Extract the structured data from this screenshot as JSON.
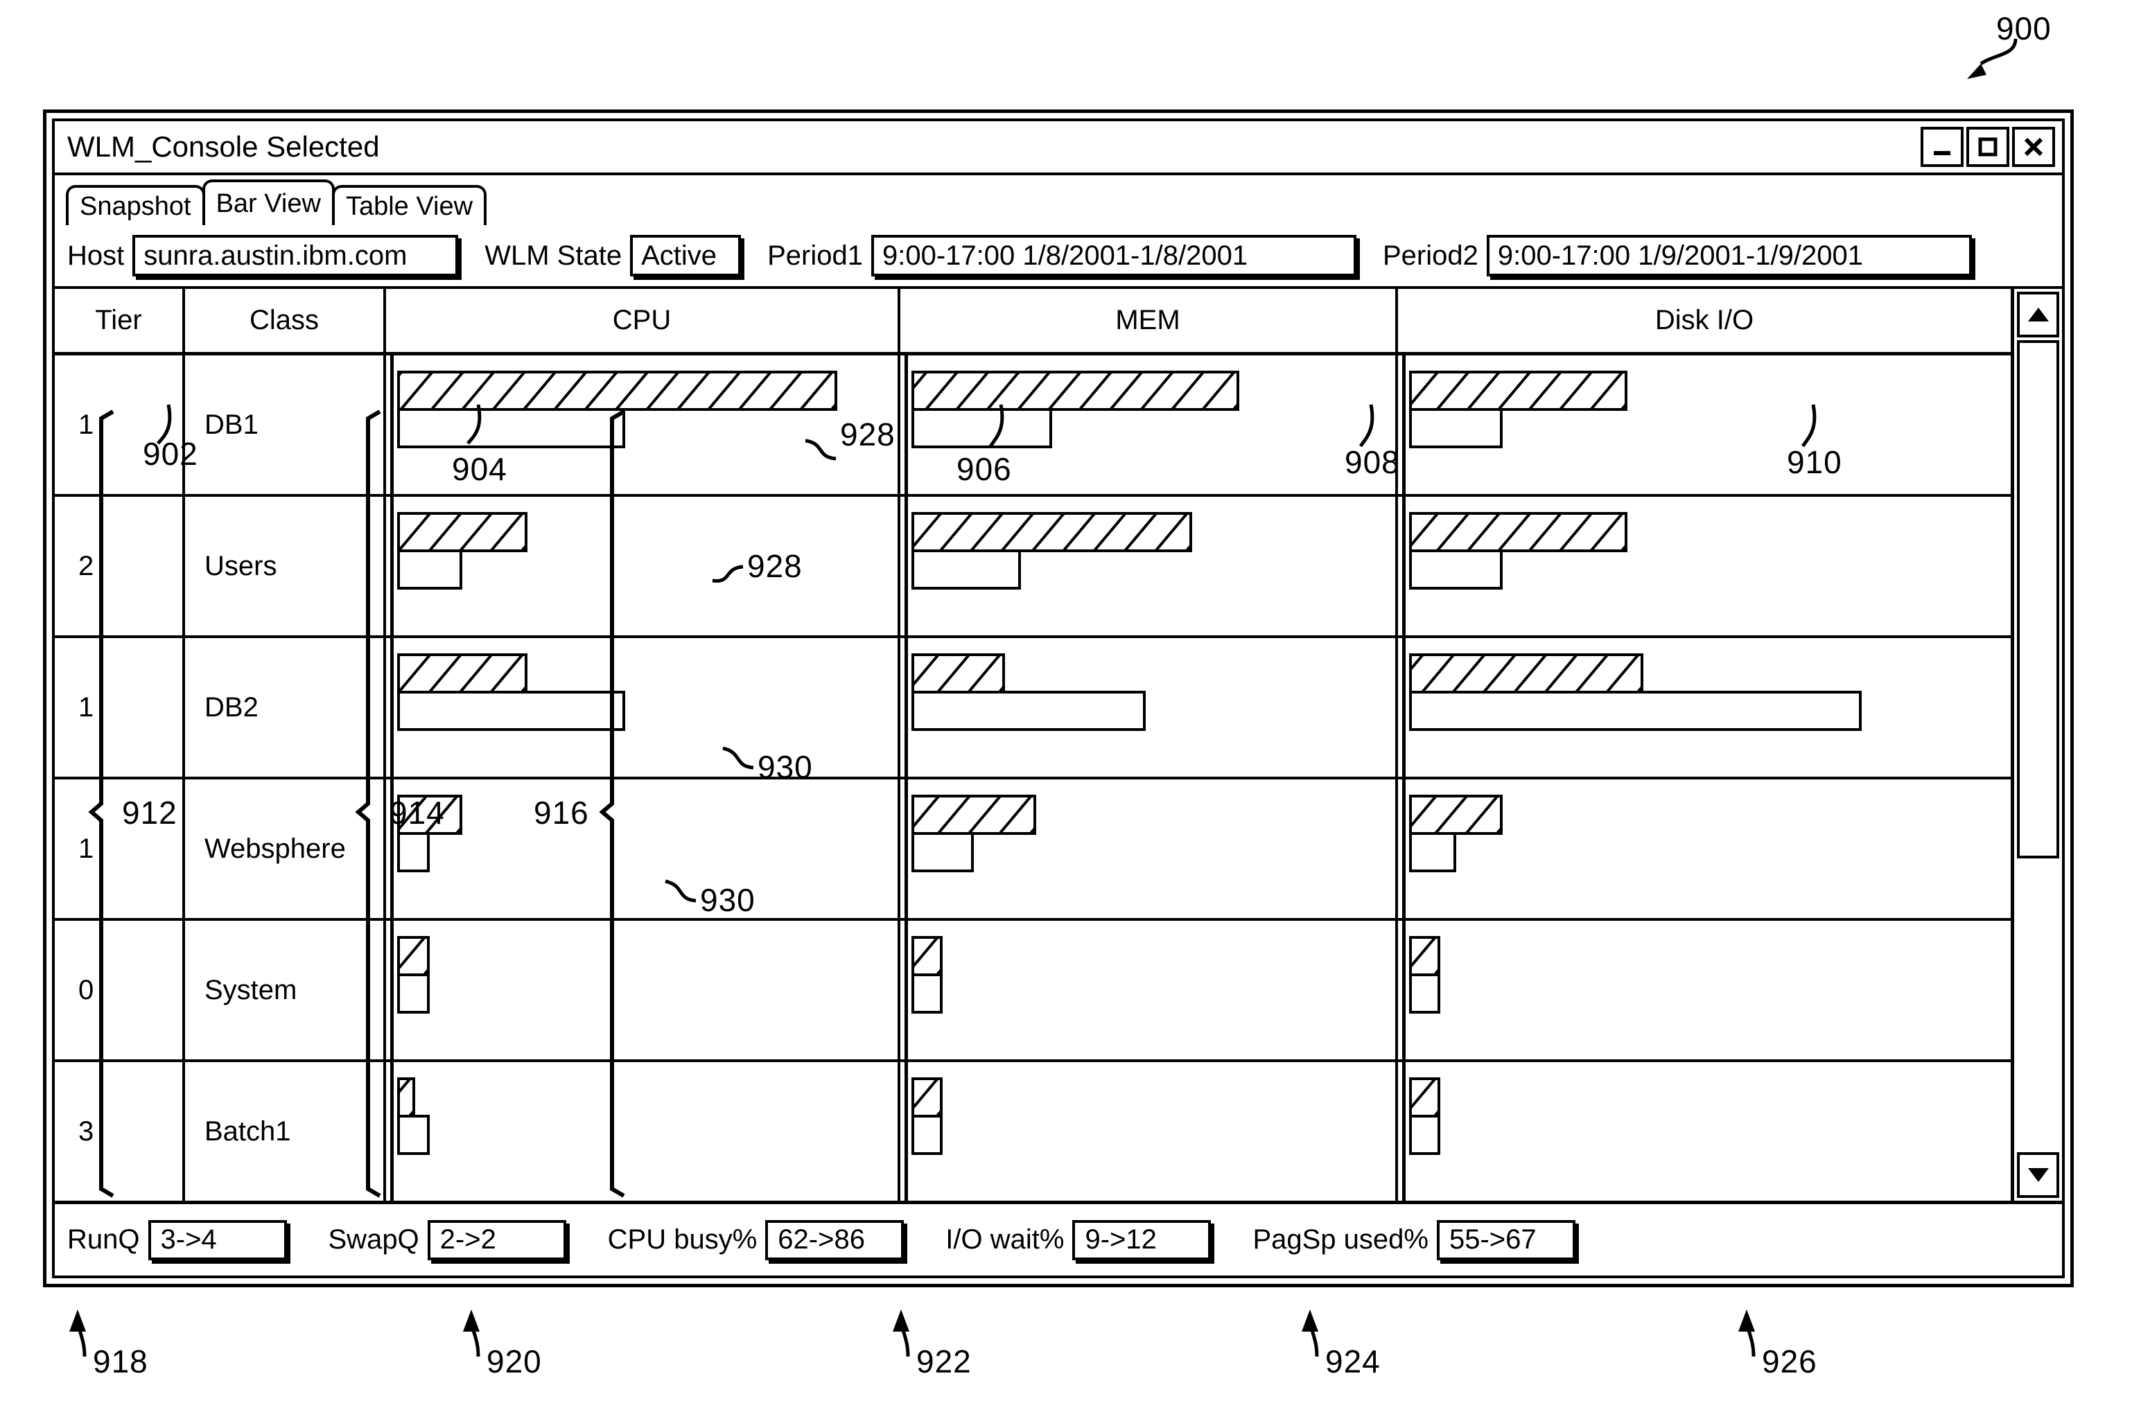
{
  "figure": {
    "reference": "900",
    "callouts": [
      {
        "id": "902",
        "target": "tier-column-annotation"
      },
      {
        "id": "904",
        "target": "class-column-annotation"
      },
      {
        "id": "906",
        "target": "cpu-column-annotation"
      },
      {
        "id": "908",
        "target": "mem-column-annotation"
      },
      {
        "id": "910",
        "target": "disk-column-annotation"
      },
      {
        "id": "912",
        "target": "tier-values-brace"
      },
      {
        "id": "914",
        "target": "class-values-brace"
      },
      {
        "id": "916",
        "target": "bar-axis-brace"
      },
      {
        "id": "928",
        "target": "period1-bar"
      },
      {
        "id": "930",
        "target": "period2-bar"
      },
      {
        "id": "918",
        "target": "runq-field"
      },
      {
        "id": "920",
        "target": "swapq-field"
      },
      {
        "id": "922",
        "target": "cpu-busy-field"
      },
      {
        "id": "924",
        "target": "io-wait-field"
      },
      {
        "id": "926",
        "target": "pagsp-used-field"
      }
    ]
  },
  "window": {
    "title": "WLM_Console Selected",
    "controls": [
      {
        "name": "minimize-button",
        "glyph": "minimize"
      },
      {
        "name": "maximize-button",
        "glyph": "maximize"
      },
      {
        "name": "close-button",
        "glyph": "close"
      }
    ]
  },
  "tabs": [
    {
      "label": "Snapshot",
      "active": false
    },
    {
      "label": "Bar View",
      "active": true
    },
    {
      "label": "Table View",
      "active": false
    }
  ],
  "toolbar": {
    "host_label": "Host",
    "host_value": "sunra.austin.ibm.com",
    "state_label": "WLM State",
    "state_value": "Active",
    "period1_label": "Period1",
    "period1_value": "9:00-17:00 1/8/2001-1/8/2001",
    "period2_label": "Period2",
    "period2_value": "9:00-17:00 1/9/2001-1/9/2001"
  },
  "grid": {
    "columns": [
      "Tier",
      "Class",
      "CPU",
      "MEM",
      "Disk I/O"
    ],
    "rows": [
      {
        "tier": "1",
        "class": "DB1"
      },
      {
        "tier": "2",
        "class": "Users"
      },
      {
        "tier": "1",
        "class": "DB2"
      },
      {
        "tier": "1",
        "class": "Websphere"
      },
      {
        "tier": "0",
        "class": "System"
      },
      {
        "tier": "3",
        "class": "Batch1"
      }
    ]
  },
  "chart_data": {
    "type": "bar",
    "title": "WLM Bar View resource utilization by class",
    "orientation": "horizontal",
    "categories": [
      "DB1",
      "Users",
      "DB2",
      "Websphere",
      "System",
      "Batch1"
    ],
    "metrics": [
      "CPU",
      "MEM",
      "Disk I/O"
    ],
    "series": [
      {
        "name": "Period1",
        "style": "hatched",
        "callout": "928"
      },
      {
        "name": "Period2",
        "style": "plain",
        "callout": "930"
      }
    ],
    "units": "percent-of-column-width",
    "axis_max": 100,
    "grid": false,
    "legend": "none",
    "values": {
      "CPU": {
        "Period1": [
          27,
          8,
          8,
          4,
          2,
          1
        ],
        "Period2": [
          14,
          4,
          14,
          2,
          2,
          2
        ]
      },
      "MEM": {
        "Period1": [
          21,
          18,
          6,
          8,
          2,
          2
        ],
        "Period2": [
          9,
          7,
          15,
          4,
          2,
          2
        ]
      },
      "Disk I/O": {
        "Period1": [
          14,
          14,
          15,
          6,
          2,
          2
        ],
        "Period2": [
          6,
          6,
          29,
          3,
          2,
          2
        ]
      }
    }
  },
  "statusbar": {
    "items": [
      {
        "label": "RunQ",
        "value": "3->4",
        "callout": "918"
      },
      {
        "label": "SwapQ",
        "value": "2->2",
        "callout": "920"
      },
      {
        "label": "CPU busy%",
        "value": "62->86",
        "callout": "922"
      },
      {
        "label": "I/O wait%",
        "value": "9->12",
        "callout": "924"
      },
      {
        "label": "PagSp used%",
        "value": "55->67",
        "callout": "926"
      }
    ]
  },
  "scrollbar": {
    "up_icon": "triangle-up-icon",
    "down_icon": "triangle-down-icon",
    "thumb_position": "top"
  }
}
